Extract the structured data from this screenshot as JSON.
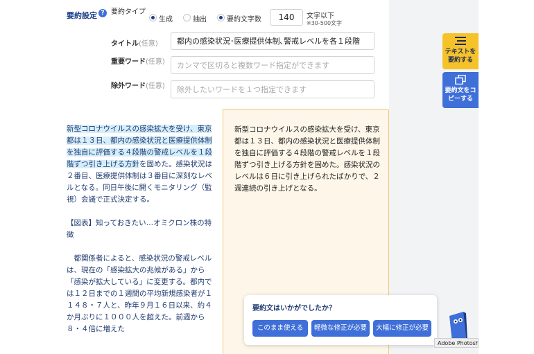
{
  "settings": {
    "section_label": "要約設定",
    "help_icon": "question-icon",
    "type_label": "要約タイプ",
    "radio_generate": "生成",
    "radio_extract": "抽出",
    "radio_chars": "要約文字数",
    "char_count": "140",
    "char_unit": "文字以下",
    "char_note": "※30-500文字",
    "title_label": "タイトル",
    "title_optional": "(任意)",
    "title_value": "都内の感染状況･医療提供体制､警戒レベルを各１段階",
    "keyword_label": "重要ワード",
    "keyword_optional": "(任意)",
    "keyword_placeholder": "カンマで区切ると複数ワード指定ができます",
    "exclude_label": "除外ワード",
    "exclude_optional": "(任意)",
    "exclude_placeholder": "除外したいワードを１つ指定できます"
  },
  "source": {
    "para1_highlight": "新型コロナウイルスの感染拡大を受け、東京都は１３日、都内の感染状況と医療提供体制を独自に評価する４段階の警戒レベルを１段階ずつ引き上げる方針",
    "para1_rest": "を固めた。感染状況は２番目、医療提供体制は３番目に深刻なレベルとなる。同日午後に開くモニタリング（監視）会議で正式決定する。",
    "para2": "【図表】知っておきたい…オミクロン株の特徴",
    "para3": "　都関係者によると、感染状況の警戒レベルは、現在の「感染拡大の兆候がある」から「感染が拡大している」に変更する。都内では１２日までの１週間の平均新規感染者が１１４８・７人と、昨年９月１６日以来、約４か月ぶりに１０００人を超えた。前週から８・４倍に増えた"
  },
  "summary": {
    "text": "新型コロナウイルスの感染拡大を受け、東京都は１３日、都内の感染状況と医療提供体制を独自に評価する４段階の警戒レベルを１段階ずつ引き上げる方針を固めた。感染状況のレベルは６日に引き上げられたばかりで、２週連続の引き上げとなる。"
  },
  "side": {
    "summarize_label": "テキストを要約する",
    "summarize_icon": "list-icon",
    "copy_label": "要約文をコピーする",
    "copy_icon": "copy-icon"
  },
  "feedback": {
    "question": "要約文はいかがでしたか？",
    "btn_ok": "このまま使える",
    "btn_minor": "軽微な修正が必要",
    "btn_major": "大幅に修正が必要"
  },
  "tooltip": "Adobe Photoshop",
  "colors": {
    "primary": "#3f6fd8",
    "navy": "#1a3e8a",
    "highlight": "#d6eefb",
    "summary_bg": "#fdf6e9",
    "accent_yellow": "#f5c229"
  }
}
